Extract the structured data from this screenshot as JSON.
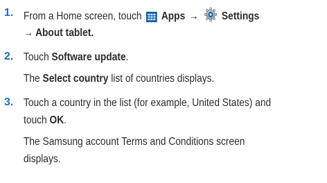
{
  "steps": [
    {
      "num": "1.",
      "lines": [
        {
          "pre": "From a Home screen, touch",
          "apps_label": "Apps",
          "arrow": "→",
          "settings_label": "Settings"
        },
        {
          "arrow": "→",
          "label": "About tablet."
        }
      ]
    },
    {
      "num": "2.",
      "lines": [
        {
          "pre": "Touch",
          "bold": "Software update",
          "post": "."
        },
        {
          "pre": "The",
          "bold": "Select country",
          "post": "list of countries displays."
        }
      ]
    },
    {
      "num": "3.",
      "lines": [
        {
          "text": "Touch a country in the list (for example, United States) and"
        },
        {
          "pre": "touch",
          "bold": "OK",
          "post": "."
        },
        {
          "text": "The Samsung account Terms and Conditions screen"
        },
        {
          "text": "displays."
        }
      ]
    }
  ],
  "icons": {
    "apps": "apps-grid-icon",
    "settings": "settings-gear-icon"
  },
  "colors": {
    "step_number": "#1f6fb5",
    "text": "#2b2b2b",
    "apps_icon": "#1f6fb5"
  }
}
